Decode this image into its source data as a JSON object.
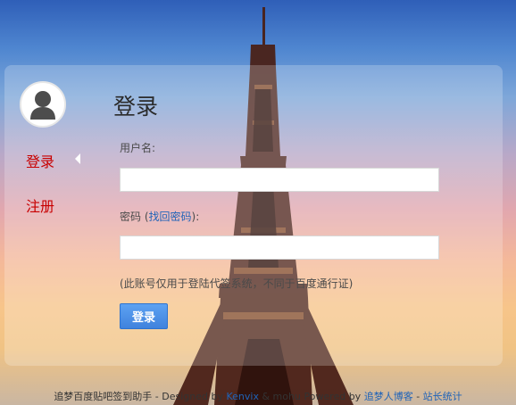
{
  "page": {
    "title": "登录"
  },
  "sidebar": {
    "items": [
      {
        "label": "登录"
      },
      {
        "label": "注册"
      }
    ]
  },
  "form": {
    "username_label": "用户名:",
    "password_label_prefix": "密码 (",
    "forgot_password_link": "找回密码",
    "password_label_suffix": "):",
    "username_value": "",
    "password_value": "",
    "note": "(此账号仅用于登陆代签系统，不同于百度通行证)",
    "submit_label": "登录"
  },
  "footer": {
    "site_name": "追梦百度贴吧签到助手",
    "separator_1": " - ",
    "designed_by": "Designed by ",
    "designer_link": "Kenvix",
    "powered_by": " & mohu Powered by ",
    "powered_link": "追梦人博客",
    "separator_2": " - ",
    "stats_link": "站长统计"
  },
  "colors": {
    "sidebar_link": "#c80000",
    "button": "#4a8de6",
    "link": "#1f63b8"
  },
  "icons": {
    "avatar": "user-icon",
    "active_indicator": "caret-left-icon"
  }
}
